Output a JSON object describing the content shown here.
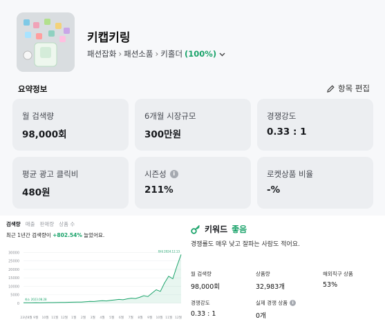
{
  "product": {
    "title": "키캡키링",
    "breadcrumb": [
      "패션잡화",
      "패션소품",
      "키홀더"
    ],
    "match_pct": "(100%)"
  },
  "summary": {
    "title": "요약정보",
    "edit_label": "항목 편집",
    "cards": [
      {
        "label": "월 검색량",
        "value": "98,000회"
      },
      {
        "label": "6개월 시장규모",
        "value": "300만원"
      },
      {
        "label": "경쟁강도",
        "value": "0.33 : 1"
      },
      {
        "label": "평균 광고 클릭비",
        "value": "480원"
      },
      {
        "label": "시즌성",
        "value": "211%"
      },
      {
        "label": "로켓상품 비율",
        "value": "-%"
      }
    ]
  },
  "trend": {
    "tabs": [
      "검색량",
      "매출",
      "판매량",
      "상품 수"
    ],
    "desc_prefix": "최근 1년간 검색량이",
    "desc_change": "+802.54%",
    "desc_suffix": "늘었어요."
  },
  "keyword": {
    "heading": "키워드",
    "grade": "좋음",
    "description": "경쟁률도 매우 낮고 잘파는 사람도 적어요.",
    "stats": [
      {
        "label": "월 검색량",
        "value": "98,000회"
      },
      {
        "label": "상품량",
        "value": "32,983개"
      },
      {
        "label": "해외직구 상품",
        "value": "53%"
      },
      {
        "label": "경쟁강도",
        "value": "0.33 : 1"
      },
      {
        "label": "실제 경쟁 상품",
        "value": "0개"
      }
    ]
  },
  "colors": {
    "accent_green": "#1aa36a",
    "card_bg": "#eceef1",
    "page_bg": "#f7f8fa"
  },
  "chart_data": {
    "type": "line",
    "series": [
      {
        "values": [
          320,
          300,
          340,
          360,
          330,
          380,
          420,
          400,
          450,
          520,
          500,
          600,
          650,
          700,
          680,
          900,
          1100,
          1050,
          1300,
          1500,
          1400,
          1700,
          2000,
          2300,
          2100,
          2600,
          3000,
          2800,
          3500,
          4500,
          4000,
          6000,
          8000,
          7000,
          12000,
          16000,
          14500,
          22000,
          28800
        ]
      }
    ],
    "yticks": [
      0,
      5000,
      10000,
      15000,
      20000,
      25000,
      30000
    ],
    "ylim": [
      0,
      31000
    ],
    "xticks": [
      "23년8월",
      "9월",
      "10월",
      "11월",
      "12월",
      "1월",
      "2월",
      "3월",
      "4월",
      "5월",
      "6월",
      "7월",
      "8월",
      "9월",
      "10월",
      "11월",
      "12월"
    ],
    "annotations": {
      "min": "최소 2023.08.28",
      "max": "최대 2024.12.13"
    }
  }
}
